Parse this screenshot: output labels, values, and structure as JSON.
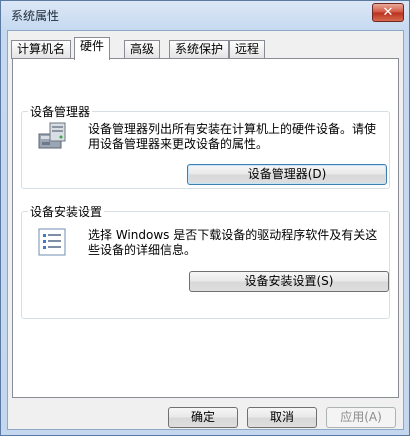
{
  "window": {
    "title": "系统属性",
    "close_symbol": "✕"
  },
  "tabs": [
    {
      "label": "计算机名",
      "active": false
    },
    {
      "label": "硬件",
      "active": true
    },
    {
      "label": "高级",
      "active": false
    },
    {
      "label": "系统保护",
      "active": false
    },
    {
      "label": "远程",
      "active": false
    }
  ],
  "device_manager": {
    "group_label": "设备管理器",
    "icon": "device-manager-icon",
    "description": "设备管理器列出所有安装在计算机上的硬件设备。请使用设备管理器来更改设备的属性。",
    "button_label": "设备管理器(D)"
  },
  "device_install": {
    "group_label": "设备安装设置",
    "icon": "checklist-icon",
    "description": "选择 Windows 是否下载设备的驱动程序软件及有关这些设备的详细信息。",
    "button_label": "设备安装设置(S)"
  },
  "footer": {
    "ok_label": "确定",
    "cancel_label": "取消",
    "apply_label": "应用(A)"
  },
  "colors": {
    "annotation_highlight": "#e53434",
    "title_bar": "#c6d9f0"
  }
}
